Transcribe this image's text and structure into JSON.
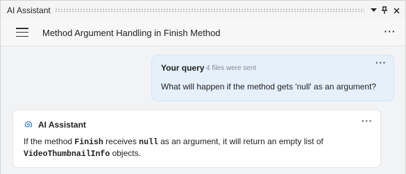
{
  "window": {
    "title": "AI Assistant",
    "controls": [
      "chevron-down-icon",
      "pin-icon",
      "close-icon"
    ]
  },
  "header": {
    "menu_icon": "hamburger-icon",
    "conversation_title": "Method Argument Handling in Finish Method",
    "more_icon": "more-horizontal-icon",
    "more_label": "···"
  },
  "messages": [
    {
      "role": "user",
      "sender": "Your query",
      "meta": "4 files were sent",
      "text": "What will happen if the method gets 'null' as an argument?",
      "more_label": "···"
    },
    {
      "role": "assistant",
      "sender": "AI Assistant",
      "icon": "ai-spiral-icon",
      "more_label": "···",
      "parts": [
        {
          "text": "If the method ",
          "code": false
        },
        {
          "text": "Finish",
          "code": true
        },
        {
          "text": " receives ",
          "code": false
        },
        {
          "text": "null",
          "code": true
        },
        {
          "text": " as an argument, it will return an empty list of",
          "code": false
        },
        {
          "text": "VideoThumbnailInfo",
          "code": true
        },
        {
          "text": " objects.",
          "code": false
        }
      ]
    }
  ],
  "colors": {
    "user_bubble": "#e5f0fb",
    "ai_bubble": "#ffffff",
    "chat_background": "#f2f3f5",
    "ai_icon": "#3b7fd6"
  }
}
